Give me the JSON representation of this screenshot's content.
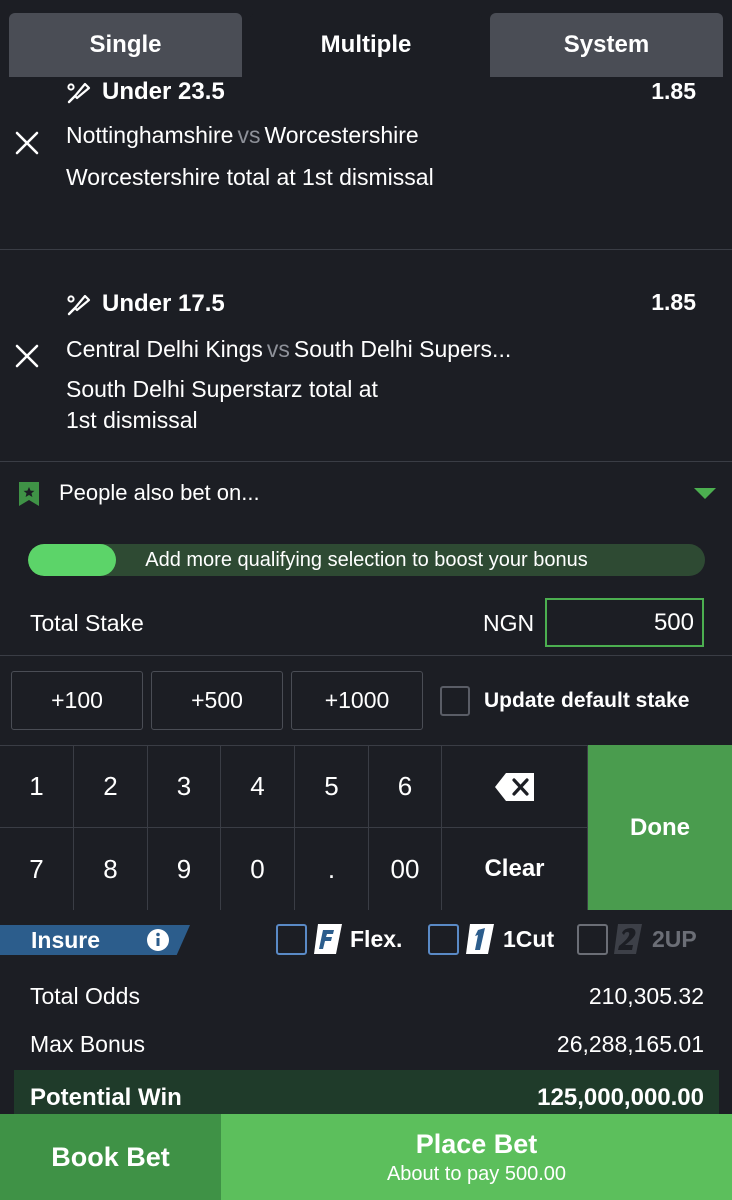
{
  "tabs": [
    "Single",
    "Multiple",
    "System"
  ],
  "active_tab": "Multiple",
  "selections": [
    {
      "market": "Under 23.5",
      "odds": "1.85",
      "home": "Nottinghamshire",
      "vs": "vs",
      "away": "Worcestershire",
      "description": "Worcestershire total at 1st dismissal"
    },
    {
      "market": "Under 17.5",
      "odds": "1.85",
      "home": "Central Delhi Kings",
      "vs": "vs",
      "away": "South Delhi Supers...",
      "description_line1": "South Delhi Superstarz total at",
      "description_line2": "1st dismissal"
    }
  ],
  "people_also_bet": "People also bet on...",
  "bonus": {
    "text": "Add more qualifying selection to boost your bonus",
    "progress": 0.13
  },
  "stake": {
    "label": "Total Stake",
    "currency": "NGN",
    "value": "500"
  },
  "quick_stakes": [
    "+100",
    "+500",
    "+1000"
  ],
  "update_default_label": "Update default stake",
  "keypad": {
    "row1": [
      "1",
      "2",
      "3",
      "4",
      "5",
      "6"
    ],
    "row2": [
      "7",
      "8",
      "9",
      "0",
      ".",
      "00"
    ],
    "clear": "Clear",
    "done": "Done"
  },
  "insure": {
    "label": "Insure",
    "options": [
      "Flex.",
      "1Cut",
      "2UP"
    ]
  },
  "totals": {
    "total_odds_label": "Total Odds",
    "total_odds": "210,305.32",
    "max_bonus_label": "Max Bonus",
    "max_bonus": "26,288,165.01",
    "potential_win_label": "Potential Win",
    "potential_win": "125,000,000.00"
  },
  "footer": {
    "book_bet": "Book Bet",
    "place_bet": "Place Bet",
    "pay_text": "About to pay 500.00"
  },
  "colors": {
    "background": "#1c1e24",
    "accent_green": "#5cbf5c",
    "insure_blue": "#2c5d8c"
  }
}
